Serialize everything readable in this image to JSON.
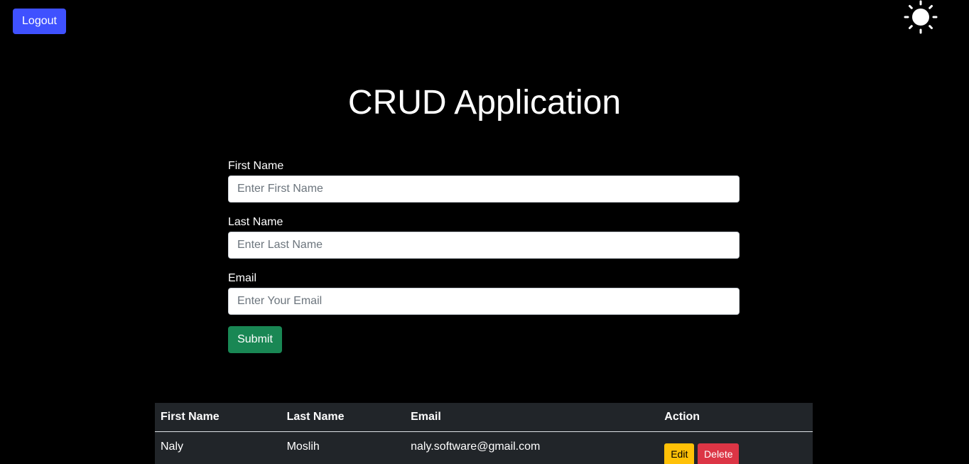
{
  "header": {
    "logout_label": "Logout",
    "theme_icon": "sun-icon"
  },
  "page": {
    "title": "CRUD Application"
  },
  "form": {
    "first_name": {
      "label": "First Name",
      "placeholder": "Enter First Name",
      "value": ""
    },
    "last_name": {
      "label": "Last Name",
      "placeholder": "Enter Last Name",
      "value": ""
    },
    "email": {
      "label": "Email",
      "placeholder": "Enter Your Email",
      "value": ""
    },
    "submit_label": "Submit"
  },
  "table": {
    "headers": [
      "First Name",
      "Last Name",
      "Email",
      "Action"
    ],
    "rows": [
      {
        "first_name": "Naly",
        "last_name": "Moslih",
        "email": "naly.software@gmail.com",
        "edit_label": "Edit",
        "delete_label": "Delete"
      }
    ]
  },
  "colors": {
    "background": "#000000",
    "logout_button": "#3f51ff",
    "submit_button": "#198754",
    "edit_button": "#ffc107",
    "delete_button": "#dc3545",
    "table_background": "#212529"
  }
}
